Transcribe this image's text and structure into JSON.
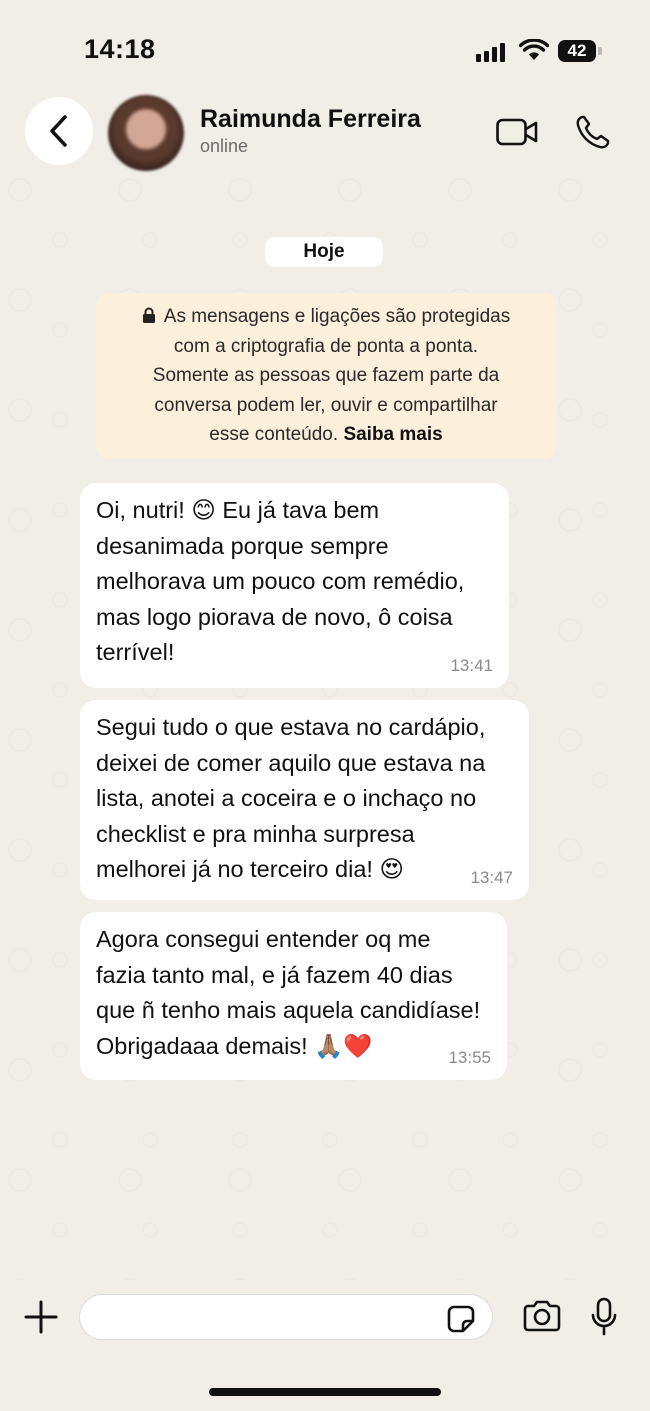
{
  "status_bar": {
    "time": "14:18",
    "battery": "42"
  },
  "header": {
    "contact_name": "Raimunda Ferreira",
    "presence": "online"
  },
  "day_label": "Hoje",
  "encryption_notice": {
    "lines": [
      "As mensagens e ligações são protegidas",
      "com a criptografia de ponta a ponta.",
      "Somente as pessoas que fazem parte da",
      "conversa podem ler, ouvir e compartilhar",
      "esse conteúdo."
    ],
    "link": "Saiba mais"
  },
  "messages": [
    {
      "lines": [
        "Oi, nutri! 😊 Eu já tava bem",
        "desanimada porque sempre",
        "melhorava um pouco com remédio,",
        "mas logo piorava de novo, ô coisa",
        "terrível!"
      ],
      "time": "13:41"
    },
    {
      "lines": [
        "Segui tudo o que estava no cardápio,",
        "deixei de comer aquilo que estava na",
        "lista, anotei a coceira e o inchaço no",
        "checklist e pra minha surpresa",
        "melhorei já no terceiro dia! 😍"
      ],
      "time": "13:47"
    },
    {
      "lines": [
        "Agora consegui entender oq me",
        "fazia tanto mal, e já fazem 40 dias",
        "que ñ tenho mais aquela candidíase!",
        "Obrigadaaa demais! 🙏🏽❤️"
      ],
      "time": "13:55"
    }
  ],
  "composer": {
    "value": ""
  },
  "icons": {
    "back": "chevron-left-icon",
    "video": "video-camera-icon",
    "call": "phone-icon",
    "attach": "plus-icon",
    "sticker": "sticker-icon",
    "camera": "camera-icon",
    "mic": "microphone-icon",
    "lock": "lock-icon"
  },
  "colors": {
    "background": "#f1eee8",
    "bubble": "#ffffff",
    "notice_bg": "#fcefdc",
    "timestamp": "#8a8a8a"
  }
}
